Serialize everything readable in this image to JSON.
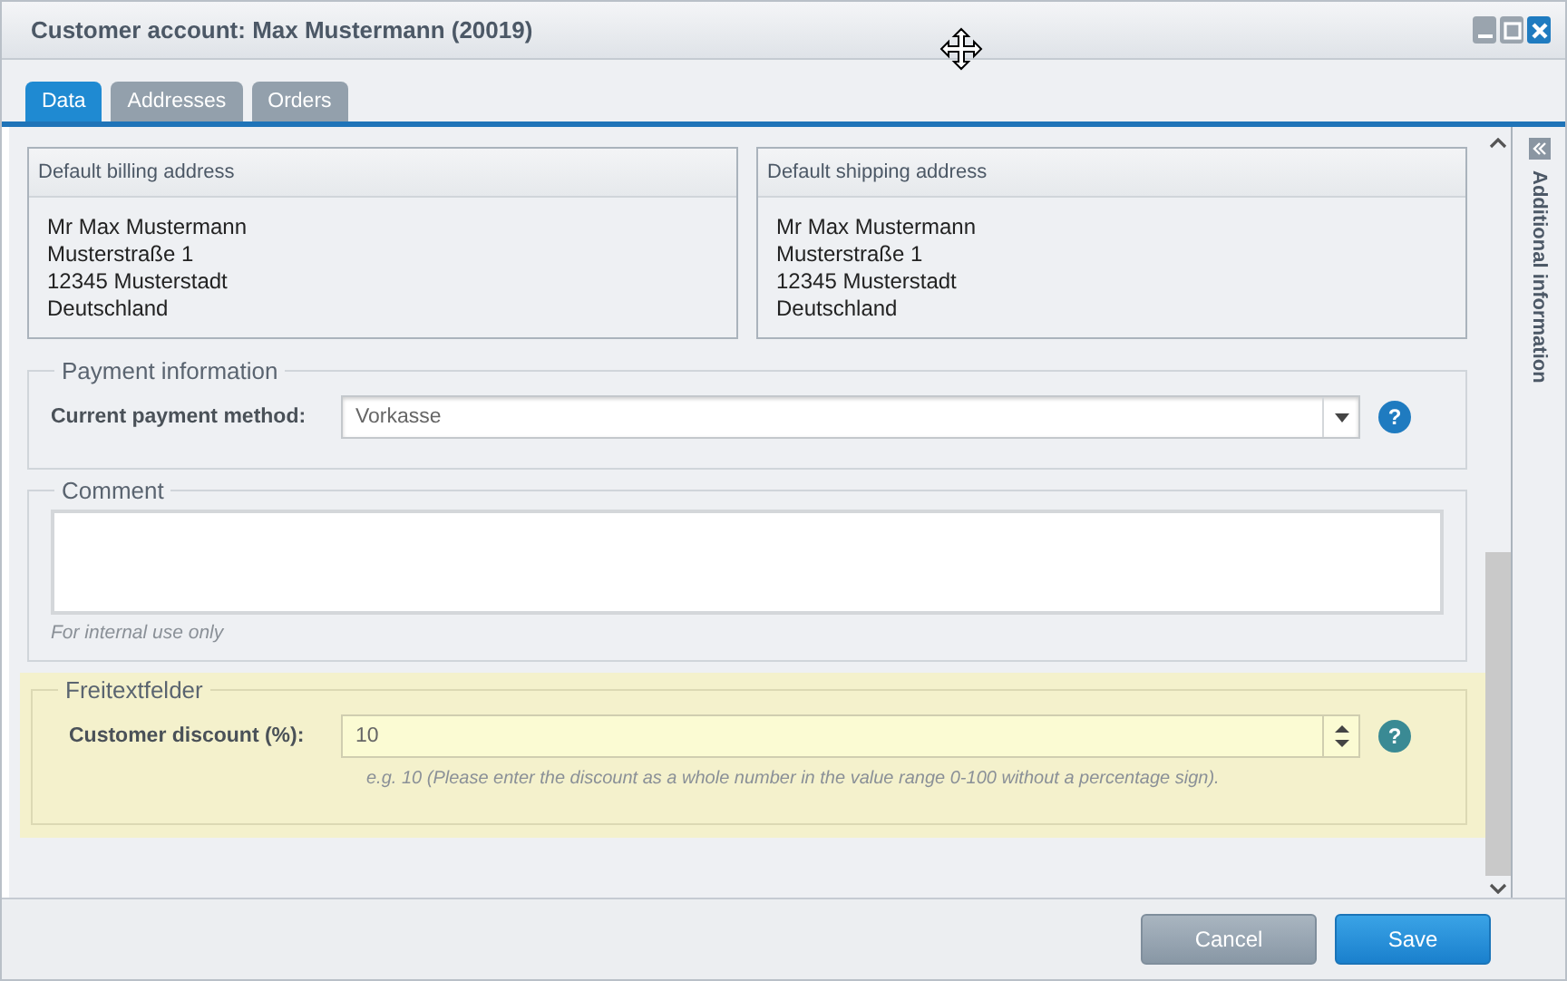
{
  "window": {
    "title": "Customer account: Max Mustermann (20019)"
  },
  "tabs": [
    {
      "label": "Data",
      "selected": true
    },
    {
      "label": "Addresses",
      "selected": false
    },
    {
      "label": "Orders",
      "selected": false
    }
  ],
  "addresses": [
    {
      "title": "Default billing address",
      "lines": [
        "Mr Max Mustermann",
        "Musterstraße 1",
        "12345 Musterstadt",
        "Deutschland"
      ]
    },
    {
      "title": "Default shipping address",
      "lines": [
        "Mr Max Mustermann",
        "Musterstraße 1",
        "12345 Musterstadt",
        "Deutschland"
      ]
    }
  ],
  "payment": {
    "legend": "Payment information",
    "label": "Current payment method:",
    "value": "Vorkasse",
    "help": "?"
  },
  "comment": {
    "legend": "Comment",
    "hint": "For internal use only"
  },
  "freetext": {
    "legend": "Freitextfelder",
    "label": "Customer discount (%):",
    "value": "10",
    "hint": "e.g. 10 (Please enter the discount as a whole number in the value range 0-100 without a percentage sign).",
    "help": "?"
  },
  "sidebar": {
    "title": "Additional information"
  },
  "buttons": [
    {
      "label": "Cancel",
      "kind": "secondary"
    },
    {
      "label": "Save",
      "kind": "primary"
    }
  ]
}
